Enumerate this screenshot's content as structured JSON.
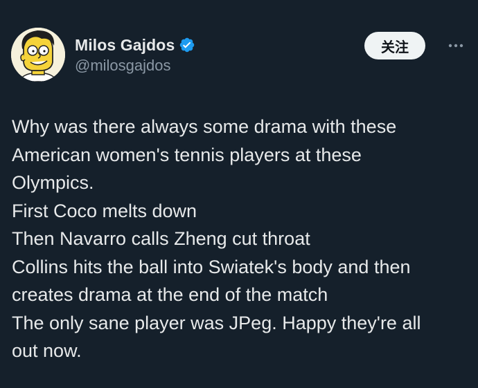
{
  "author": {
    "display_name": "Milos Gajdos",
    "handle": "@milosgajdos",
    "verified_icon": "verified-badge-icon",
    "avatar_icon": "cartoon-avatar-icon"
  },
  "actions": {
    "follow_label": "关注",
    "more_icon": "more-options-icon"
  },
  "tweet": {
    "lines": [
      "Why was there always some drama with these",
      "American women's tennis players at these",
      "Olympics.",
      "First Coco melts down",
      "Then Navarro calls Zheng cut throat",
      "Collins hits the ball into Swiatek's body and then",
      "creates drama at the end of the match",
      "The only sane player was JPeg. Happy they're all",
      "out now."
    ]
  },
  "colors": {
    "background": "#15202b",
    "text": "#e7e9ea",
    "secondary_text": "#8b98a5",
    "verified": "#1d9bf0",
    "button_bg": "#eff3f4"
  }
}
